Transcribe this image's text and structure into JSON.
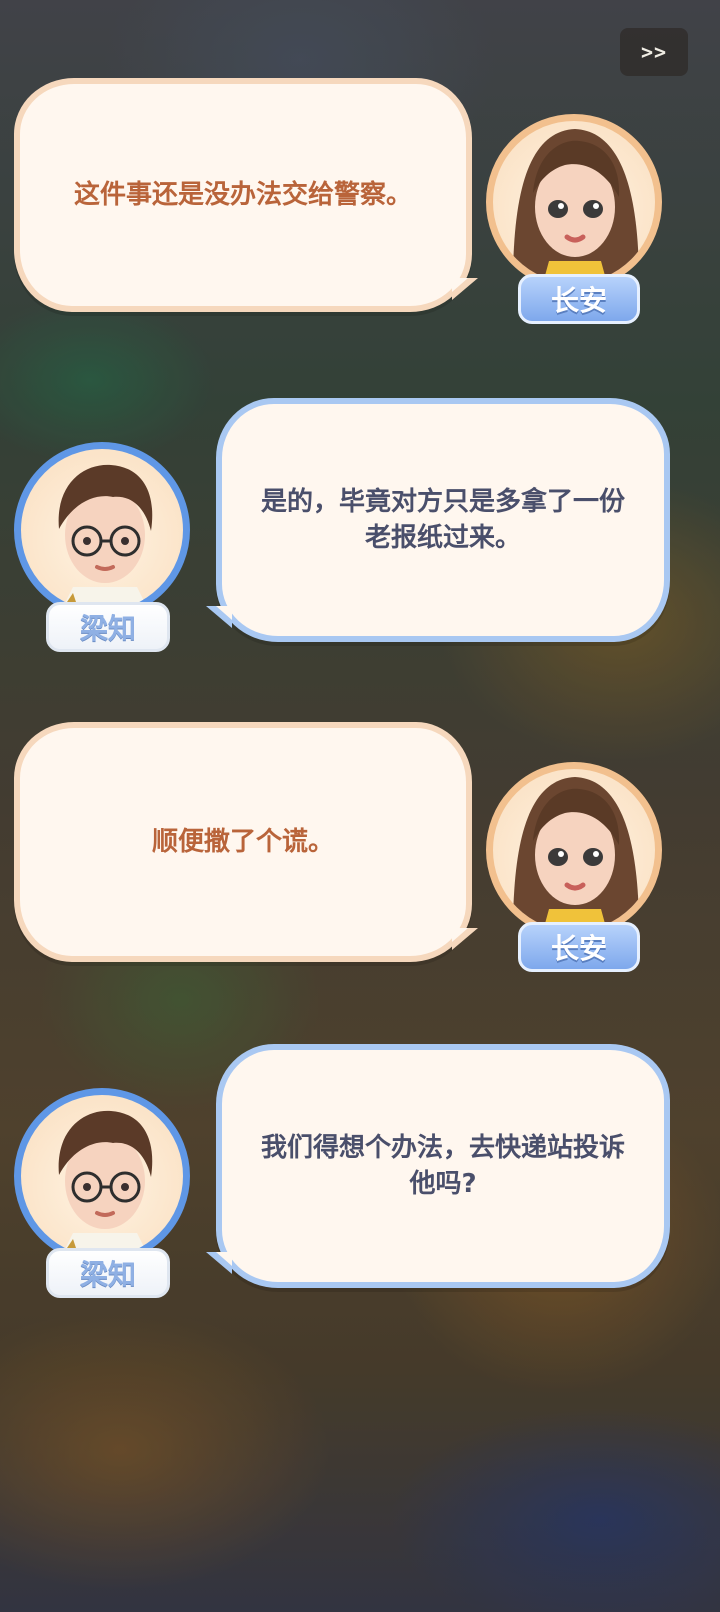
{
  "controls": {
    "skip_label": ">>"
  },
  "dialogue": [
    {
      "speaker": "长安",
      "text": "这件事还是没办法交给警察。"
    },
    {
      "speaker": "梁知",
      "text": "是的，毕竟对方只是多拿了一份\n老报纸过来。"
    },
    {
      "speaker": "长安",
      "text": "顺便撒了个谎。"
    },
    {
      "speaker": "梁知",
      "text": "我们得想个办法，去快递站投诉\n他吗?"
    }
  ],
  "colors": {
    "changan_bubble_border": "#f6d8bd",
    "changan_text": "#b9643a",
    "liangzhi_bubble_border": "#a9c8f2",
    "liangzhi_text": "#4a4f6b",
    "changan_ring": "#f2c08e",
    "liangzhi_ring": "#5f97e6"
  }
}
